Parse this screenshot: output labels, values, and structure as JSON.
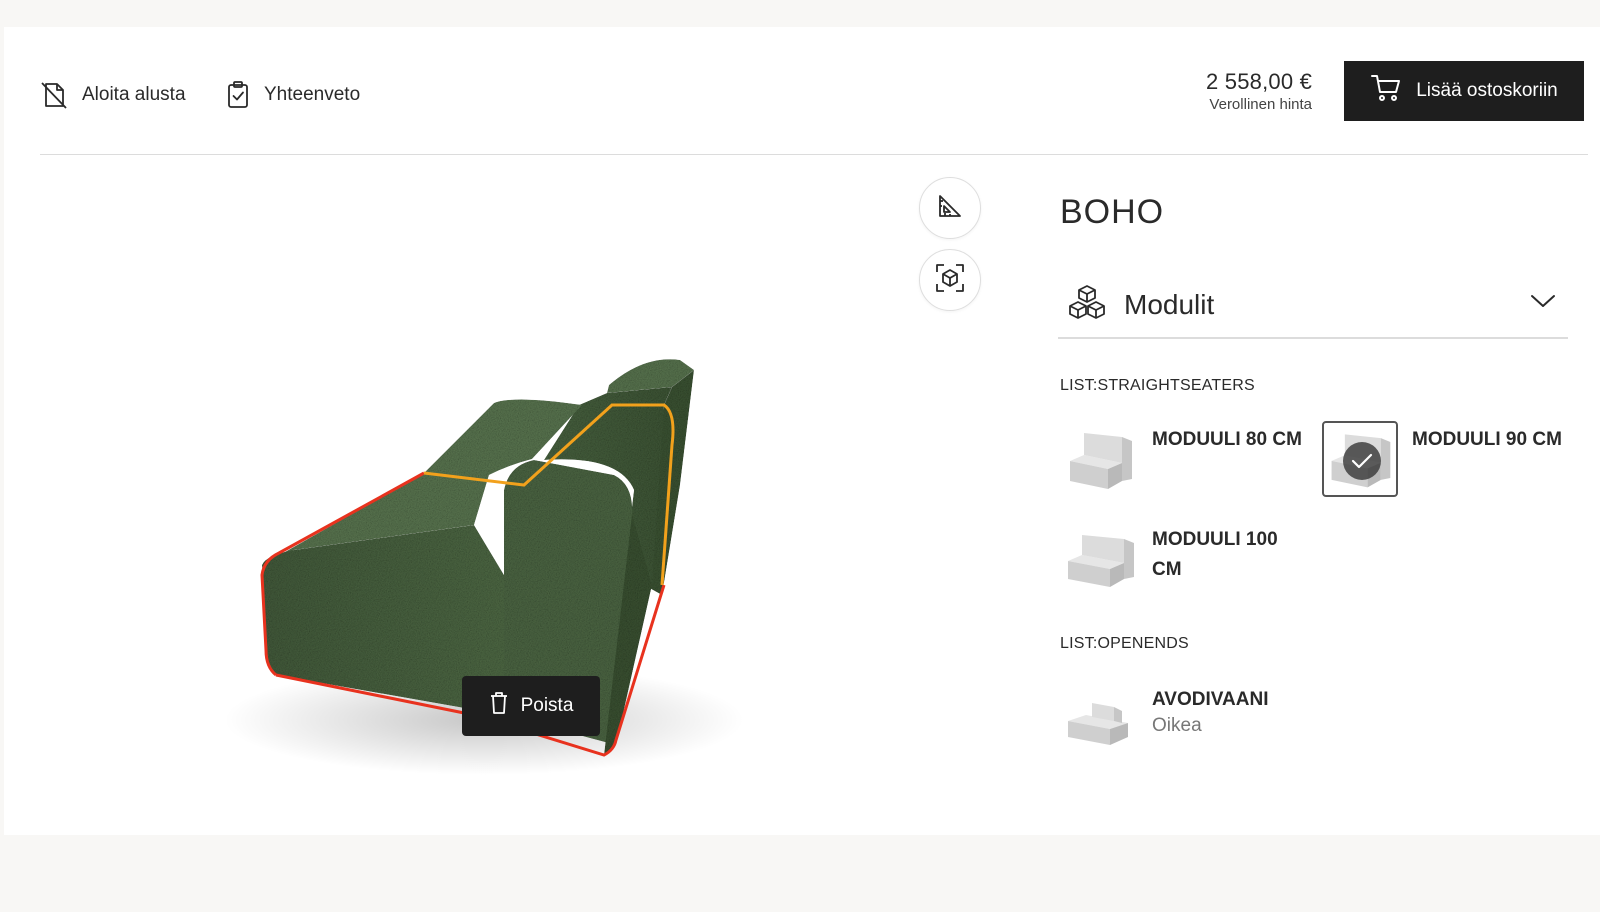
{
  "toolbar": {
    "restart_label": "Aloita alusta",
    "summary_label": "Yhteenveto",
    "price": "2 558,00 €",
    "price_caption": "Verollinen hinta",
    "cart_label": "Lisää ostoskoriin"
  },
  "viewer": {
    "delete_label": "Poista",
    "sofa_color": "#4f6a45",
    "highlight_red": "#e8321e",
    "highlight_orange": "#f2a11c"
  },
  "panel": {
    "product_title": "BOHO",
    "accordion_title": "Modulit",
    "sections": [
      {
        "label": "LIST:STRAIGHTSEATERS",
        "modules": [
          {
            "name": "MODUULI 80 CM",
            "selected": false
          },
          {
            "name": "MODUULI 90 CM",
            "selected": true
          },
          {
            "name": "MODUULI 100 CM",
            "selected": false
          }
        ]
      },
      {
        "label": "LIST:OPENENDS",
        "modules": [
          {
            "name": "AVODIVAANI",
            "sub": "Oikea",
            "selected": false
          }
        ]
      }
    ]
  }
}
